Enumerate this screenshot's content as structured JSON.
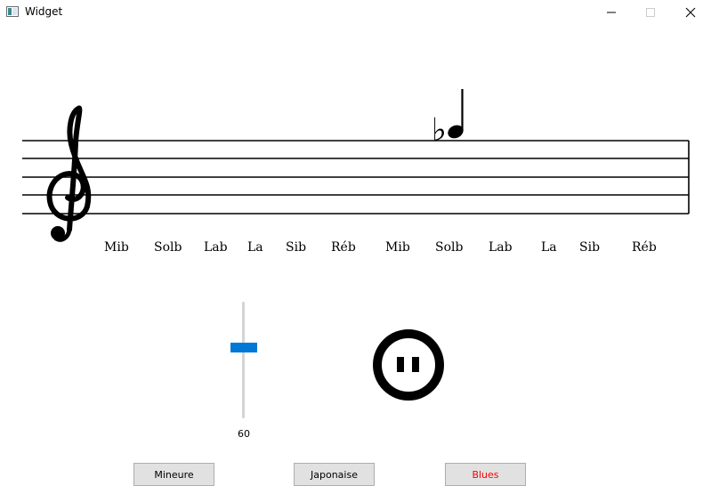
{
  "window": {
    "title": "Widget"
  },
  "staff": {
    "clef": "treble-clef",
    "note_accidental": "♭",
    "note_labels": [
      "Mib",
      "Solb",
      "Lab",
      "La",
      "Sib",
      "Réb",
      "Mib",
      "Solb",
      "Lab",
      "La",
      "Sib",
      "Réb"
    ]
  },
  "slider": {
    "value": "60"
  },
  "pause": {
    "icon": "pause-icon"
  },
  "buttons": {
    "mineure": "Mineure",
    "japonaise": "Japonaise",
    "blues": "Blues",
    "blues_color": "#ff0000"
  },
  "colors": {
    "accent": "#0078d7"
  }
}
